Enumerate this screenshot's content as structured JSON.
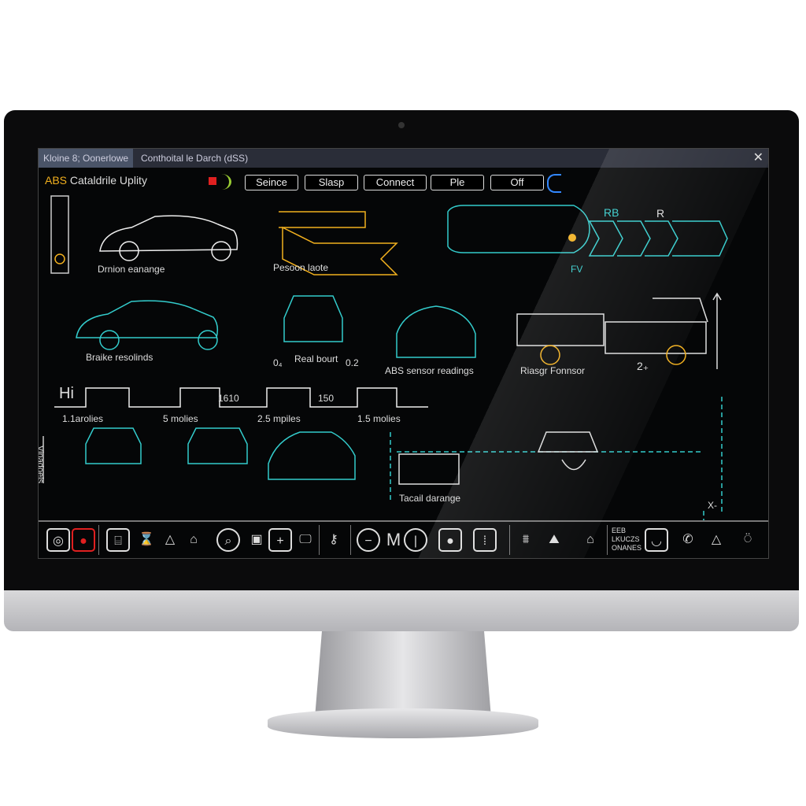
{
  "window": {
    "tab_active": "Kloine 8; Oonerlowe",
    "tab_title": "Conthoital le Darch (dSS)",
    "close": "✕"
  },
  "app": {
    "title_prefix": "ABS",
    "title": "Cataldrile Uplity"
  },
  "toolbar_buttons": [
    "Seince",
    "Slasp",
    "Connect",
    "Ple",
    "Off"
  ],
  "labels": {
    "drnion": "Drnion eanange",
    "pesoon": "Pesoon laote",
    "rb": "RB",
    "r": "R",
    "fv": "FV",
    "braike": "Braike resolinds",
    "o4": "0₄",
    "real_bourt": "Real bourt",
    "o2": "0.2",
    "abs_readings": "ABS sensor readings",
    "riasgr": "Riasgr Fonnsor",
    "two": "2₊",
    "hi": "Hi",
    "m1": "1.1arolies",
    "m2": "5 molies",
    "v1": "1610",
    "m3": "2.5 mpiles",
    "v2": "150",
    "m4": "1.5 molies",
    "vertical": "Vinadoels",
    "tacail": "Tacail darange",
    "x": "X-"
  },
  "bottom_icons": [
    "disc-icon",
    "alert-icon",
    "gauge-icon",
    "hourglass-icon",
    "warning-icon",
    "home-icon",
    "search-icon",
    "image-icon",
    "plus-icon",
    "monitor-icon",
    "tool-icon",
    "minus-icon",
    "m-icon",
    "power-icon",
    "record-icon",
    "sensor-icon",
    "car-lift-icon",
    "garage-icon",
    "house-icon",
    "text-icon",
    "phone-icon",
    "triangle-icon",
    "info-icon"
  ],
  "bottom_text": "EEB LKUCZS ONANES",
  "colors": {
    "accent": "#f2b01e",
    "teal": "#33cccc",
    "red": "#e02020"
  }
}
